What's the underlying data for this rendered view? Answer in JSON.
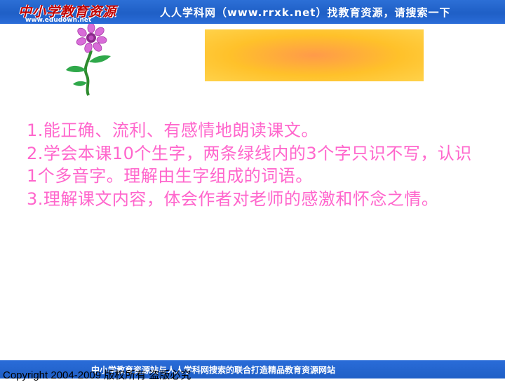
{
  "header": {
    "logo_text": "中小学教育资源",
    "logo_url": "www.edudown.net",
    "slogan": "人人学科网（www.rrxk.net）找教育资源，请搜索一下"
  },
  "slide": {
    "title": "",
    "objectives": [
      "1.能正确、流利、有感情地朗读课文。",
      "2.学会本课10个生字，两条绿线内的3个字只识不写，认识1个多音字。理解由生字组成的词语。",
      "3.理解课文内容，体会作者对老师的感激和怀念之情。"
    ]
  },
  "footer": {
    "slogan": "中小学教育资源站与人人学科网搜索的联合打造精品教育资源网站",
    "copyright": "Copyright 2004-2009 版权所有 盗版必究"
  },
  "colors": {
    "banner_blue": "#1f5fc6",
    "text_pink": "#ff66cc",
    "title_box_orange": "#ffc12a"
  },
  "icons": {
    "decoration": "flower-icon"
  }
}
